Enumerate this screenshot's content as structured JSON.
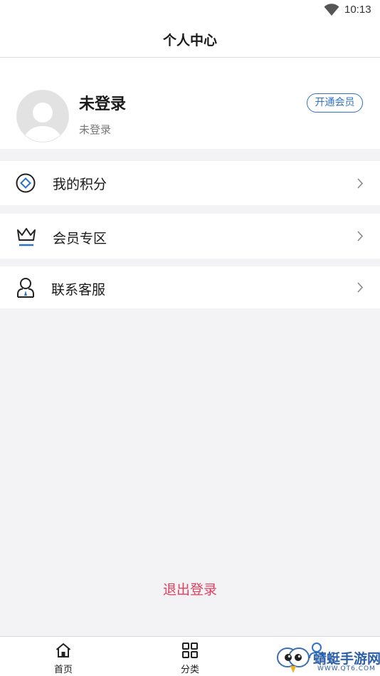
{
  "status_bar": {
    "time": "10:13",
    "icons": [
      "wifi-icon"
    ]
  },
  "nav": {
    "title": "个人中心"
  },
  "profile": {
    "name": "未登录",
    "subtitle": "未登录",
    "vip_button": "开通会员",
    "avatar_icon": "default-avatar-icon"
  },
  "menu": [
    {
      "label": "我的积分",
      "icon": "points-diamond-icon"
    },
    {
      "label": "会员专区",
      "icon": "crown-icon"
    },
    {
      "label": "联系客服",
      "icon": "customer-service-icon"
    }
  ],
  "logout": {
    "label": "退出登录"
  },
  "tabbar": [
    {
      "label": "首页",
      "icon": "home-icon"
    },
    {
      "label": "分类",
      "icon": "category-grid-icon"
    },
    {
      "label": "",
      "icon": "user-icon"
    }
  ],
  "watermark": {
    "text": "蜻蜓手游网",
    "url": "WWW.QT6.COM"
  },
  "colors": {
    "accent_blue": "#2f73c9",
    "logout_red": "#e0405e",
    "background": "#f3f3f5"
  }
}
